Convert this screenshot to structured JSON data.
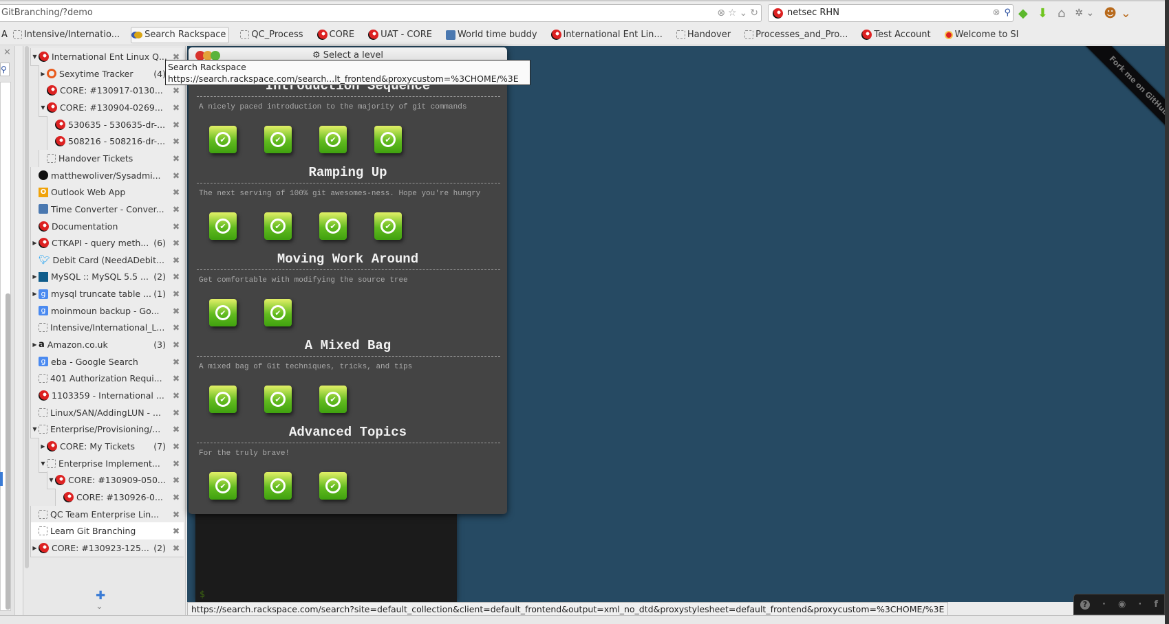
{
  "browser": {
    "url": "GitBranching/?demo",
    "search_value": "netsec RHN",
    "bookmarks": [
      "Intensive/Internatio...",
      "Search Rackspace",
      "QC_Process",
      "CORE",
      "UAT - CORE",
      "World time buddy",
      "International Ent Lin...",
      "Handover",
      "Processes_and_Pro...",
      "Test Account",
      "Welcome to SI"
    ],
    "bookmark_icons": [
      "blank",
      "rackspace-search",
      "blank",
      "rackspace",
      "rackspace",
      "clock",
      "rackspace",
      "blank",
      "blank",
      "rackspace",
      "si"
    ],
    "tooltip": {
      "title": "Search Rackspace",
      "url": "https://search.rackspace.com/search...lt_frontend&proxycustom=%3CHOME/%3E"
    },
    "status_url": "https://search.rackspace.com/search?site=default_collection&client=default_frontend&output=xml_no_dtd&proxystylesheet=default_frontend&proxycustom=%3CHOME/%3E"
  },
  "tabs_tree": [
    {
      "label": "International Ent Linux Q...",
      "level": 0,
      "toggle": "down",
      "icon": "rackspace"
    },
    {
      "label": "Sexytime Tracker",
      "level": 1,
      "toggle": "right",
      "icon": "ring",
      "count": "(4)"
    },
    {
      "label": "CORE: #130917-0130...",
      "level": 1,
      "icon": "rackspace"
    },
    {
      "label": "CORE: #130904-0269...",
      "level": 1,
      "toggle": "down",
      "icon": "rackspace"
    },
    {
      "label": "530635 - 530635-dr-...",
      "level": 2,
      "icon": "rackspace"
    },
    {
      "label": "508216 - 508216-dr-...",
      "level": 2,
      "icon": "rackspace"
    },
    {
      "label": "Handover Tickets",
      "level": 1,
      "icon": "blank"
    },
    {
      "label": "matthewoliver/Sysadmi...",
      "level": 0,
      "icon": "github"
    },
    {
      "label": "Outlook Web App",
      "level": 0,
      "icon": "outlook"
    },
    {
      "label": "Time Converter - Conver...",
      "level": 0,
      "icon": "clock"
    },
    {
      "label": "Documentation",
      "level": 0,
      "icon": "rackspace"
    },
    {
      "label": "CTKAPI - query meth...",
      "level": 0,
      "toggle": "right",
      "icon": "rackspace",
      "count": "(6)"
    },
    {
      "label": "Debit Card (NeedADebit...",
      "level": 0,
      "icon": "twitter"
    },
    {
      "label": "MySQL :: MySQL 5.5 ...",
      "level": 0,
      "toggle": "right",
      "icon": "mysql",
      "count": "(2)"
    },
    {
      "label": "mysql truncate table ...",
      "level": 0,
      "toggle": "right",
      "icon": "google",
      "count": "(1)"
    },
    {
      "label": "moinmoun backup - Go...",
      "level": 0,
      "icon": "google"
    },
    {
      "label": "Intensive/International_L...",
      "level": 0,
      "icon": "blank"
    },
    {
      "label": "Amazon.co.uk",
      "level": 0,
      "toggle": "right",
      "icon": "amazon",
      "count": "(3)"
    },
    {
      "label": "eba - Google Search",
      "level": 0,
      "icon": "google"
    },
    {
      "label": "401 Authorization Requi...",
      "level": 0,
      "icon": "blank"
    },
    {
      "label": "1103359 - International ...",
      "level": 0,
      "icon": "rackspace"
    },
    {
      "label": "Linux/SAN/AddingLUN - ...",
      "level": 0,
      "icon": "blank"
    },
    {
      "label": "Enterprise/Provisioning/...",
      "level": 0,
      "toggle": "down",
      "icon": "blank"
    },
    {
      "label": "CORE: My Tickets",
      "level": 1,
      "toggle": "right",
      "icon": "rackspace",
      "count": "(7)"
    },
    {
      "label": "Enterprise Implement...",
      "level": 1,
      "toggle": "down",
      "icon": "blank"
    },
    {
      "label": "CORE: #130909-050...",
      "level": 2,
      "toggle": "down",
      "icon": "rackspace"
    },
    {
      "label": "CORE: #130926-0...",
      "level": 3,
      "icon": "rackspace"
    },
    {
      "label": "QC Team Enterprise Lin...",
      "level": 0,
      "icon": "blank"
    },
    {
      "label": "Learn Git Branching",
      "level": 0,
      "icon": "blank",
      "active": true
    },
    {
      "label": "CORE: #130923-125...",
      "level": 0,
      "toggle": "right",
      "icon": "rackspace",
      "count": "(2)"
    }
  ],
  "level_dialog": {
    "title": "Select a level",
    "sections": [
      {
        "name": "Introduction Sequence",
        "description": "A nicely paced introduction to the majority of git commands",
        "levels": 4,
        "completed": 4
      },
      {
        "name": "Ramping Up",
        "description": "The next serving of 100% git awesomes-ness. Hope you're hungry",
        "levels": 4,
        "completed": 4
      },
      {
        "name": "Moving Work Around",
        "description": "Get comfortable with modifying the source tree",
        "levels": 2,
        "completed": 2
      },
      {
        "name": "A Mixed Bag",
        "description": "A mixed bag of Git techniques, tricks, and tips",
        "levels": 3,
        "completed": 3
      },
      {
        "name": "Advanced Topics",
        "description": "For the truly brave!",
        "levels": 3,
        "completed": 3
      }
    ]
  },
  "terminal": {
    "prompt": "$"
  },
  "ribbon": "Fork me on GitHub",
  "social": {
    "help": "?",
    "sep": "·",
    "facebook": "f"
  },
  "colors": {
    "background": "#264a63",
    "level_done": "#62bb1f",
    "panel": "#444444"
  }
}
